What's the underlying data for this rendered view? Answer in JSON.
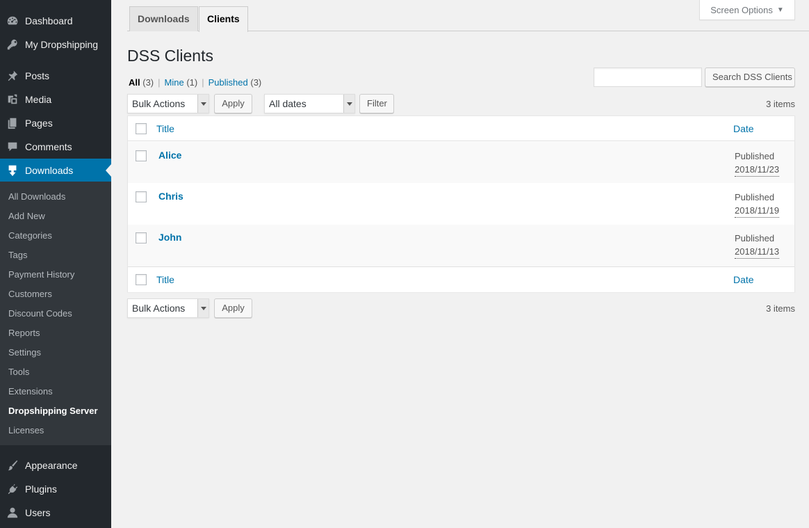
{
  "sidebar": {
    "top_items": [
      {
        "label": "Dashboard",
        "icon": "dashboard-icon"
      },
      {
        "label": "My Dropshipping",
        "icon": "key-icon"
      },
      {
        "label": "Posts",
        "icon": "pin-icon"
      },
      {
        "label": "Media",
        "icon": "media-icon"
      },
      {
        "label": "Pages",
        "icon": "pages-icon"
      },
      {
        "label": "Comments",
        "icon": "comment-icon"
      },
      {
        "label": "Downloads",
        "icon": "download-icon"
      }
    ],
    "submenu": [
      "All Downloads",
      "Add New",
      "Categories",
      "Tags",
      "Payment History",
      "Customers",
      "Discount Codes",
      "Reports",
      "Settings",
      "Tools",
      "Extensions",
      "Dropshipping Server",
      "Licenses"
    ],
    "bottom_items": [
      {
        "label": "Appearance",
        "icon": "brush-icon"
      },
      {
        "label": "Plugins",
        "icon": "plug-icon"
      },
      {
        "label": "Users",
        "icon": "user-icon"
      }
    ]
  },
  "tabs": [
    "Downloads",
    "Clients"
  ],
  "screen_options": "Screen Options",
  "page": {
    "title": "DSS Clients",
    "views": [
      {
        "label": "All",
        "count": "(3)"
      },
      {
        "label": "Mine",
        "count": "(1)"
      },
      {
        "label": "Published",
        "count": "(3)"
      }
    ],
    "search_button": "Search DSS Clients",
    "search_value": "",
    "bulk_actions": "Bulk Actions",
    "apply": "Apply",
    "all_dates": "All dates",
    "filter": "Filter",
    "items_count": "3 items"
  },
  "table": {
    "col_title": "Title",
    "col_date": "Date",
    "rows": [
      {
        "title": "Alice",
        "status": "Published",
        "date": "2018/11/23"
      },
      {
        "title": "Chris",
        "status": "Published",
        "date": "2018/11/19"
      },
      {
        "title": "John",
        "status": "Published",
        "date": "2018/11/13"
      }
    ]
  },
  "colors": {
    "sidebar_bg": "#23282d",
    "submenu_bg": "#32373c",
    "accent": "#0073aa",
    "page_bg": "#f1f1f1"
  }
}
